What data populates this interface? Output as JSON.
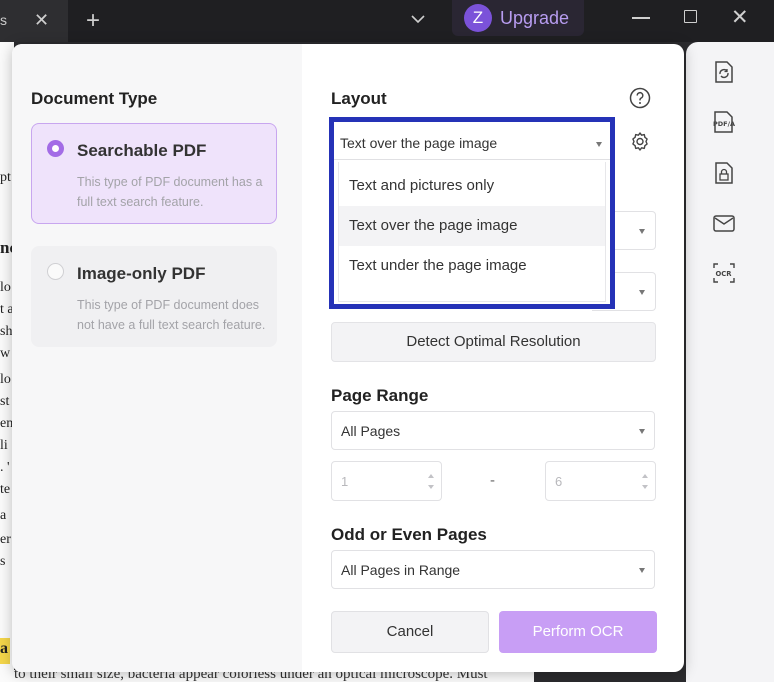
{
  "titlebar": {
    "tab_stub_text": "s",
    "upgrade_logo": "Z",
    "upgrade_label": "Upgrade"
  },
  "background_doc": {
    "edge_glyphs": [
      "pt",
      "nc",
      "lo",
      "t a",
      "sh",
      "w",
      "lo",
      "st",
      "en",
      "li",
      ". '",
      "te",
      "a",
      "er",
      "s",
      "a"
    ],
    "bottom_text": "to their small size, bacteria appear colorless under an optical microscope. Must"
  },
  "dialog": {
    "document_type": {
      "title": "Document Type",
      "options": [
        {
          "label": "Searchable PDF",
          "description": "This type of PDF document has a full text search feature.",
          "selected": true
        },
        {
          "label": "Image-only PDF",
          "description": "This type of PDF document does not have a full text search feature.",
          "selected": false
        }
      ]
    },
    "layout": {
      "title": "Layout",
      "selected": "Text over the page image",
      "options": [
        "Text and pictures only",
        "Text over the page image",
        "Text under the page image"
      ]
    },
    "detect_button": "Detect Optimal Resolution",
    "page_range": {
      "title": "Page Range",
      "selected": "All Pages",
      "from": "1",
      "to": "6",
      "separator": "-"
    },
    "odd_even": {
      "title": "Odd or Even Pages",
      "selected": "All Pages in Range"
    },
    "cancel_button": "Cancel",
    "perform_button": "Perform OCR"
  },
  "right_tools": [
    "convert-icon",
    "pdfa-icon",
    "protect-icon",
    "mail-icon",
    "ocr-icon"
  ],
  "colors": {
    "accent": "#a36ce6",
    "selected_card_bg": "#efe3fb",
    "perform_button": "#c89ef5",
    "highlight_border": "#2532b7"
  }
}
